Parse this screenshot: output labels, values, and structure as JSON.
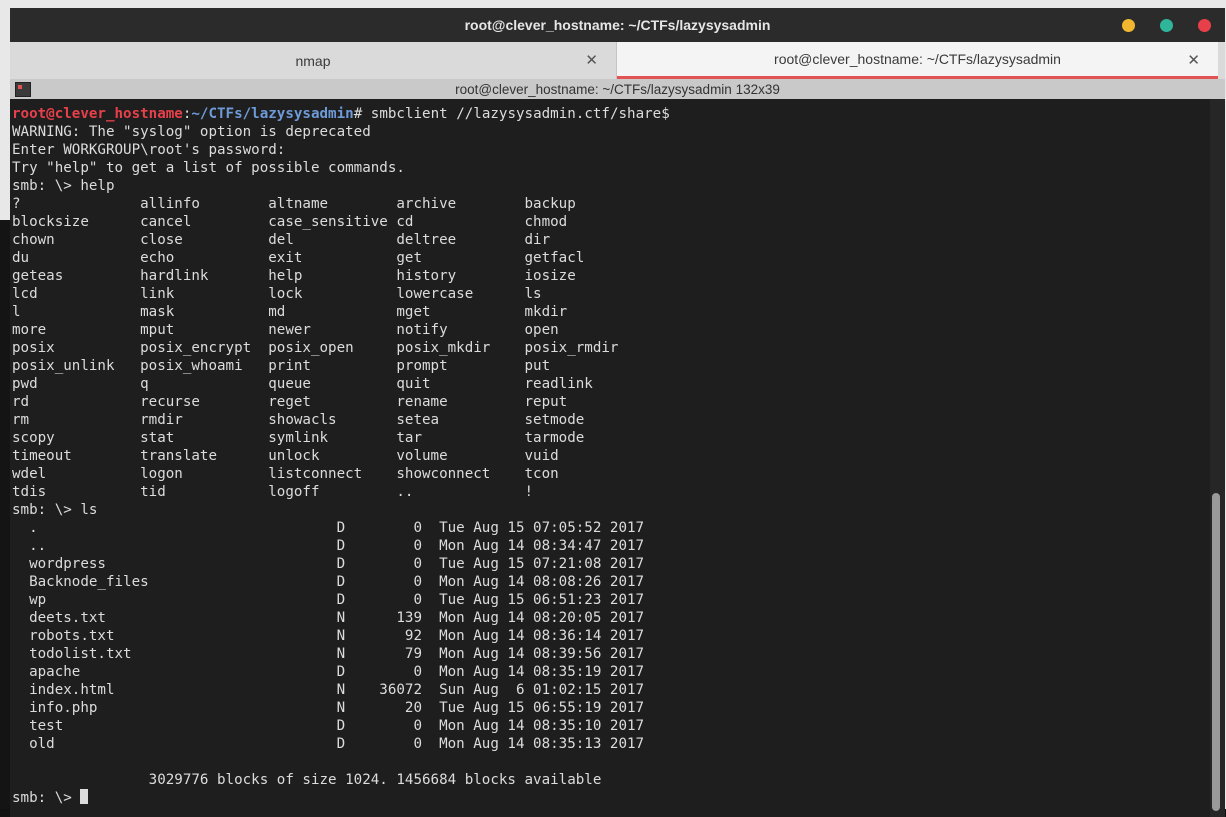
{
  "window": {
    "title": "root@clever_hostname: ~/CTFs/lazysysadmin"
  },
  "tabs": [
    {
      "label": "nmap",
      "close": "✕"
    },
    {
      "label": "root@clever_hostname: ~/CTFs/lazysysadmin",
      "close": "✕"
    }
  ],
  "terminal_info": "root@clever_hostname: ~/CTFs/lazysysadmin 132x39",
  "prompt": {
    "user": "root@clever_hostname",
    "sep": ":",
    "path": "~/CTFs/lazysysadmin",
    "symbol": "#",
    "command": " smbclient //lazysysadmin.ctf/share$"
  },
  "output_text": "WARNING: The \"syslog\" option is deprecated\nEnter WORKGROUP\\root's password: \nTry \"help\" to get a list of possible commands.\nsmb: \\> help\n?              allinfo        altname        archive        backup         \nblocksize      cancel         case_sensitive cd             chmod          \nchown          close          del            deltree        dir            \ndu             echo           exit           get            getfacl        \ngeteas         hardlink       help           history        iosize         \nlcd            link           lock           lowercase      ls             \nl              mask           md             mget           mkdir          \nmore           mput           newer          notify         open           \nposix          posix_encrypt  posix_open     posix_mkdir    posix_rmdir    \nposix_unlink   posix_whoami   print          prompt         put            \npwd            q              queue          quit           readlink       \nrd             recurse        reget          rename         reput          \nrm             rmdir          showacls       setea          setmode        \nscopy          stat           symlink        tar            tarmode        \ntimeout        translate      unlock         volume         vuid           \nwdel           logon          listconnect    showconnect    tcon           \ntdis           tid            logoff         ..             !              \nsmb: \\> ls\n  .                                   D        0  Tue Aug 15 07:05:52 2017\n  ..                                  D        0  Mon Aug 14 08:34:47 2017\n  wordpress                           D        0  Tue Aug 15 07:21:08 2017\n  Backnode_files                      D        0  Mon Aug 14 08:08:26 2017\n  wp                                  D        0  Tue Aug 15 06:51:23 2017\n  deets.txt                           N      139  Mon Aug 14 08:20:05 2017\n  robots.txt                          N       92  Mon Aug 14 08:36:14 2017\n  todolist.txt                        N       79  Mon Aug 14 08:39:56 2017\n  apache                              D        0  Mon Aug 14 08:35:19 2017\n  index.html                          N    36072  Sun Aug  6 01:02:15 2017\n  info.php                            N       20  Tue Aug 15 06:55:19 2017\n  test                                D        0  Mon Aug 14 08:35:10 2017\n  old                                 D        0  Mon Aug 14 08:35:13 2017\n\n                3029776 blocks of size 1024. 1456684 blocks available",
  "final_prompt": "smb: \\> ",
  "colors": {
    "prompt_user": "#e8404a",
    "prompt_path": "#6e9ad8",
    "terminal_bg": "#1e1e1e",
    "tab_active_underline": "#e25353"
  }
}
